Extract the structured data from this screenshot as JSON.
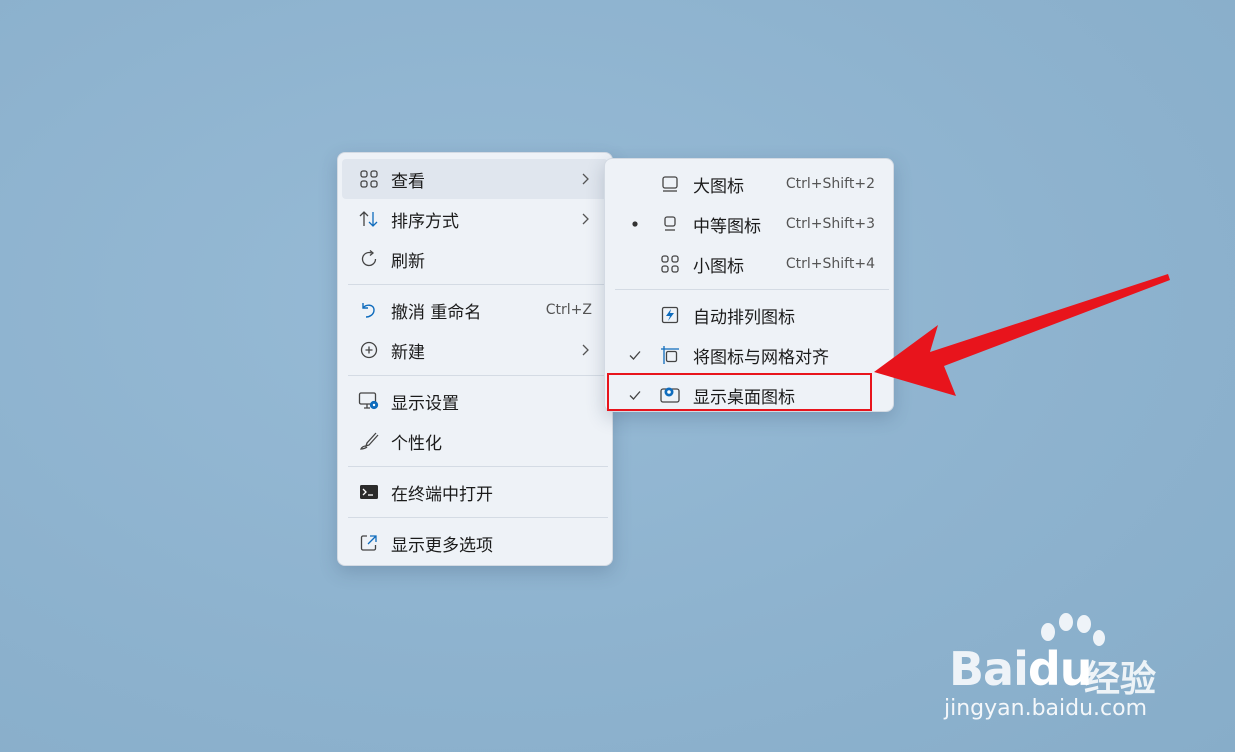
{
  "context_menu": {
    "items": [
      {
        "label": "查看",
        "icon": "view-grid-icon",
        "submenu": true
      },
      {
        "label": "排序方式",
        "icon": "sort-arrows-icon",
        "submenu": true
      },
      {
        "label": "刷新",
        "icon": "refresh-icon"
      },
      {
        "label": "撤消 重命名",
        "icon": "undo-icon",
        "shortcut": "Ctrl+Z"
      },
      {
        "label": "新建",
        "icon": "new-plus-icon",
        "submenu": true
      },
      {
        "label": "显示设置",
        "icon": "display-settings-icon"
      },
      {
        "label": "个性化",
        "icon": "brush-icon"
      },
      {
        "label": "在终端中打开",
        "icon": "terminal-icon"
      },
      {
        "label": "显示更多选项",
        "icon": "more-options-icon"
      }
    ]
  },
  "view_submenu": {
    "items": [
      {
        "label": "大图标",
        "icon": "large-icons-icon",
        "shortcut": "Ctrl+Shift+2",
        "mark": ""
      },
      {
        "label": "中等图标",
        "icon": "medium-icons-icon",
        "shortcut": "Ctrl+Shift+3",
        "mark": "bullet"
      },
      {
        "label": "小图标",
        "icon": "small-icons-icon",
        "shortcut": "Ctrl+Shift+4",
        "mark": ""
      },
      {
        "label": "自动排列图标",
        "icon": "auto-arrange-icon",
        "mark": ""
      },
      {
        "label": "将图标与网格对齐",
        "icon": "align-grid-icon",
        "mark": "check"
      },
      {
        "label": "显示桌面图标",
        "icon": "show-desktop-icons-icon",
        "mark": "check"
      }
    ]
  },
  "watermark": {
    "brand": "Bai",
    "brand_suffix": "du",
    "cn": "经验",
    "url": "jingyan.baidu.com"
  },
  "colors": {
    "annotation": "#e8141c",
    "accent": "#0f6cbd"
  }
}
